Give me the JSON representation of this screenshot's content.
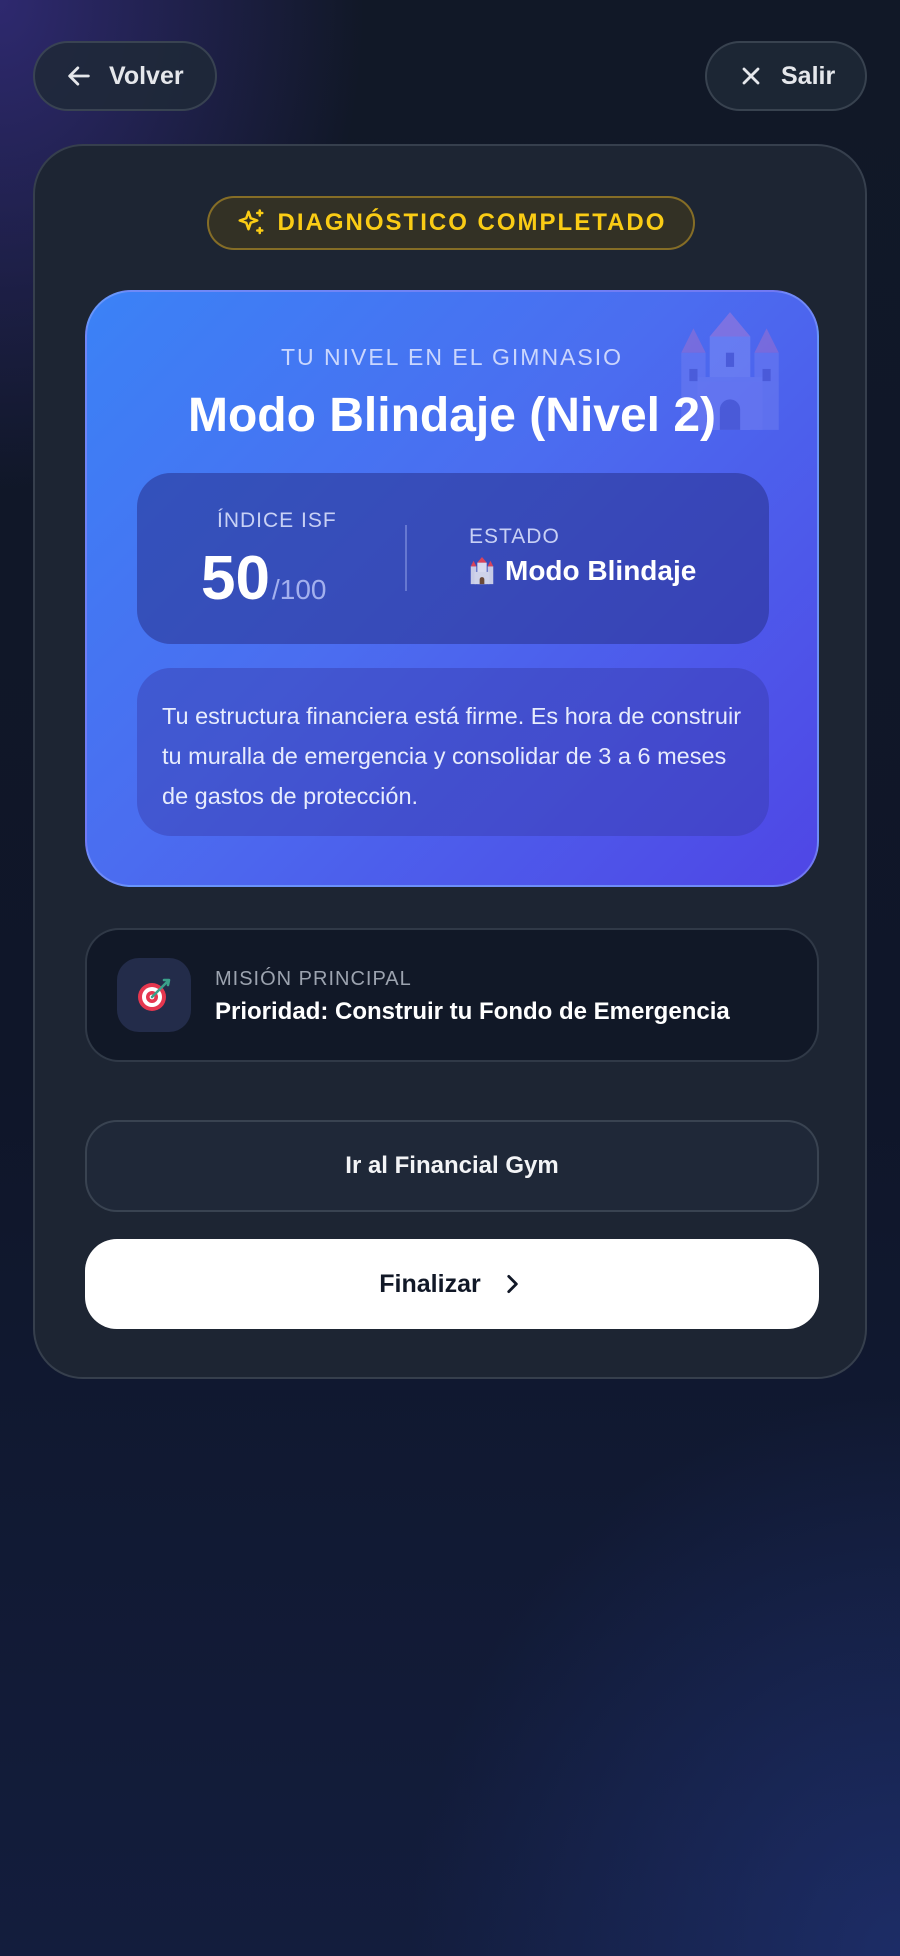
{
  "nav": {
    "back_label": "Volver",
    "back_icon": "arrow-left-icon",
    "exit_label": "Salir",
    "exit_icon": "close-icon"
  },
  "badge": {
    "label": "DIAGNÓSTICO COMPLETADO",
    "icon": "sparkles-icon",
    "color": "#facc15"
  },
  "level_card": {
    "eyebrow": "TU NIVEL EN EL GIMNASIO",
    "title": "Modo Blindaje (Nivel 2)",
    "decor_icon": "castle-icon",
    "isf": {
      "label": "ÍNDICE ISF",
      "value": "50",
      "max": "/100"
    },
    "estado": {
      "label": "ESTADO",
      "icon": "castle-icon",
      "value": "Modo Blindaje"
    },
    "description": "Tu estructura financiera está firme. Es hora de construir tu muralla de emergencia y consolidar de 3 a 6 meses de gastos de protección.",
    "gradient_start": "#3b82f6",
    "gradient_end": "#4f46e5"
  },
  "mission": {
    "icon": "target-icon",
    "label": "MISIÓN PRINCIPAL",
    "text": "Prioridad: Construir tu Fondo de Emergencia"
  },
  "actions": {
    "gym_label": "Ir al Financial Gym",
    "finish_label": "Finalizar",
    "finish_icon": "chevron-right-icon"
  }
}
